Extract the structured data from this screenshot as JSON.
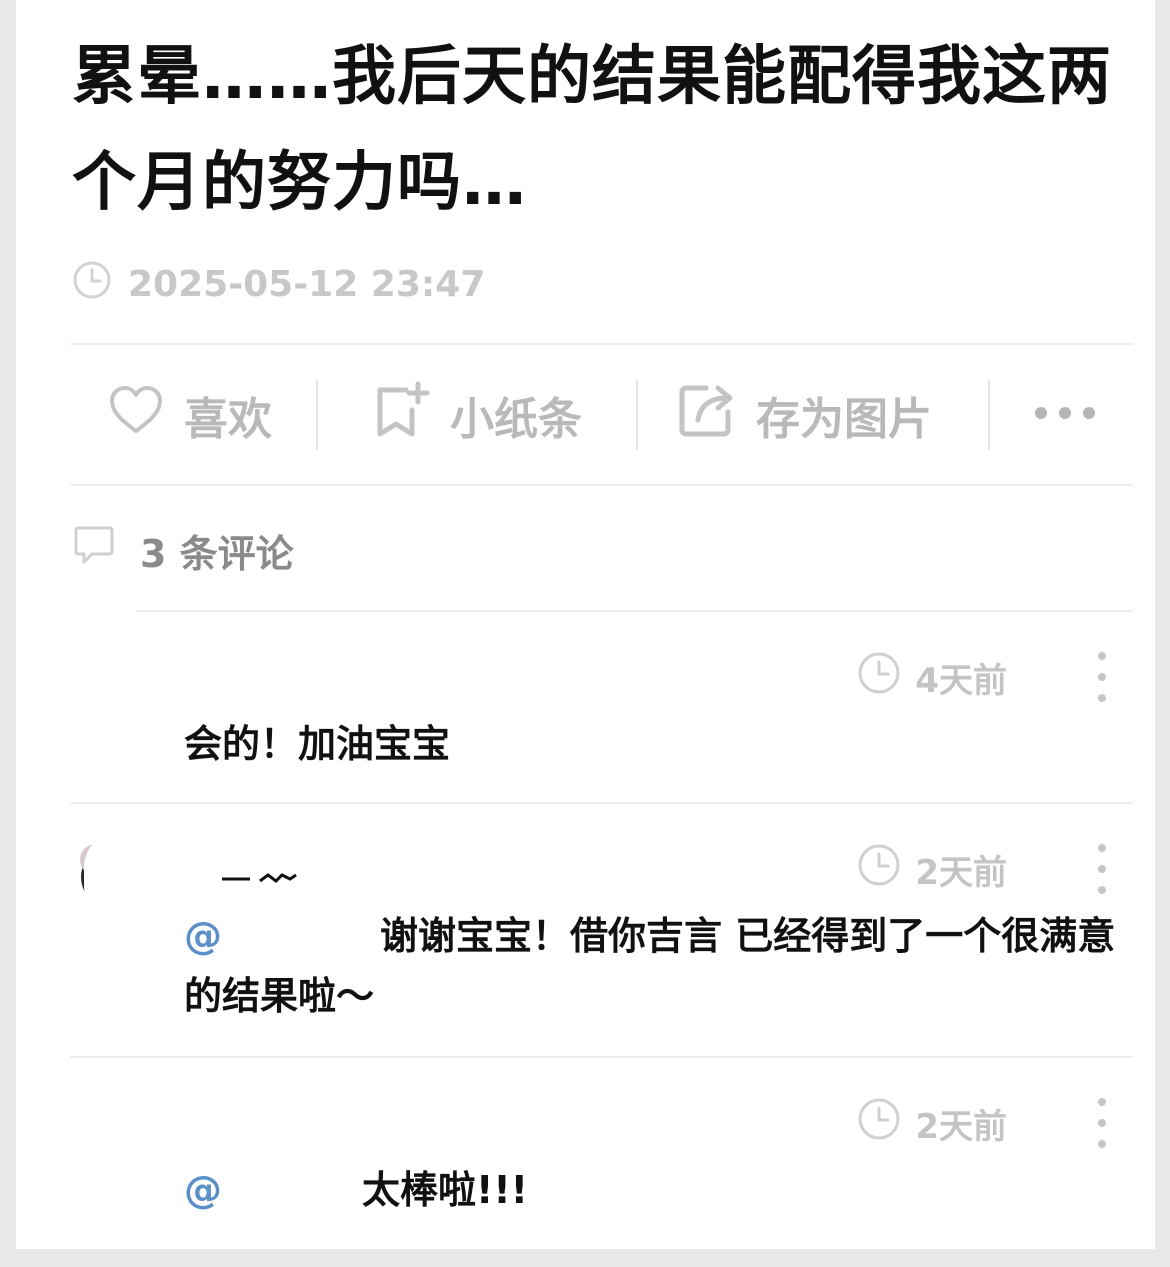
{
  "post": {
    "title": "累晕……我后天的结果能配得我这两个月的努力吗…",
    "timestamp": "2025-05-12 23:47"
  },
  "actions": {
    "like_label": "喜欢",
    "note_label": "小纸条",
    "save_image_label": "存为图片"
  },
  "comments_header": {
    "count_label": "3 条评论"
  },
  "comments": [
    {
      "time": "4天前",
      "text": "会的！加油宝宝"
    },
    {
      "time": "2天前",
      "mention_prefix": "@",
      "text_visible": "谢谢宝宝！借你吉言 已经得到了一个很满意的结果啦～"
    },
    {
      "time": "2天前",
      "mention_prefix": "@",
      "text_visible": "太棒啦!!!"
    }
  ],
  "icons": {
    "clock": "clock-icon",
    "heart": "heart-icon",
    "bookmark_add": "bookmark-add-icon",
    "share": "share-icon",
    "more": "more-horizontal-icon",
    "comment": "comment-bubble-icon",
    "kebab": "more-vertical-icon"
  },
  "colors": {
    "background": "#e9e9e9",
    "card": "#ffffff",
    "title_text": "#111111",
    "muted_text": "#b9b9b9",
    "mention": "#5a8fc7"
  }
}
